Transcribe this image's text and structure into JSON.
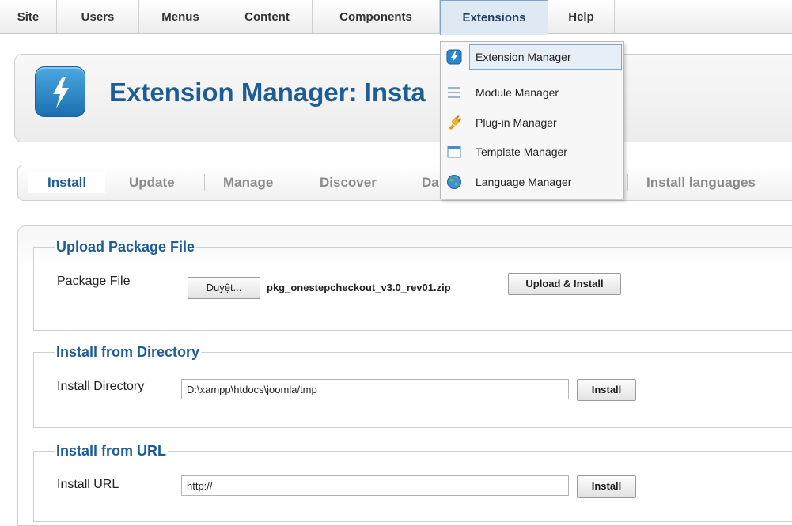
{
  "menu": {
    "items": [
      "Site",
      "Users",
      "Menus",
      "Content",
      "Components",
      "Extensions",
      "Help"
    ],
    "active": "Extensions"
  },
  "dropdown": {
    "items": [
      {
        "label": "Extension Manager",
        "icon": "extension-manager-icon",
        "highlighted": true
      },
      {
        "label": "Module Manager",
        "icon": "module-manager-icon"
      },
      {
        "label": "Plug-in Manager",
        "icon": "plugin-manager-icon"
      },
      {
        "label": "Template Manager",
        "icon": "template-manager-icon"
      },
      {
        "label": "Language Manager",
        "icon": "language-manager-icon"
      }
    ]
  },
  "header": {
    "title": "Extension Manager: Insta",
    "icon": "lightning-bolt-icon"
  },
  "subtabs": {
    "install": "Install",
    "update": "Update",
    "manage": "Manage",
    "discover": "Discover",
    "database_partial": "Da",
    "install_languages": "Install languages"
  },
  "upload": {
    "legend": "Upload Package File",
    "label": "Package File",
    "browse_button": "Duyệt...",
    "filename": "pkg_onestepcheckout_v3.0_rev01.zip",
    "submit": "Upload & Install"
  },
  "directory": {
    "legend": "Install from Directory",
    "label": "Install Directory",
    "value": "D:\\xampp\\htdocs\\joomla/tmp",
    "submit": "Install"
  },
  "url": {
    "legend": "Install from URL",
    "label": "Install URL",
    "value": "http://",
    "submit": "Install"
  },
  "colors": {
    "accent": "#1d5c95",
    "highlight_border": "#7ea6cf",
    "highlight_bg": "#e6eef7"
  }
}
